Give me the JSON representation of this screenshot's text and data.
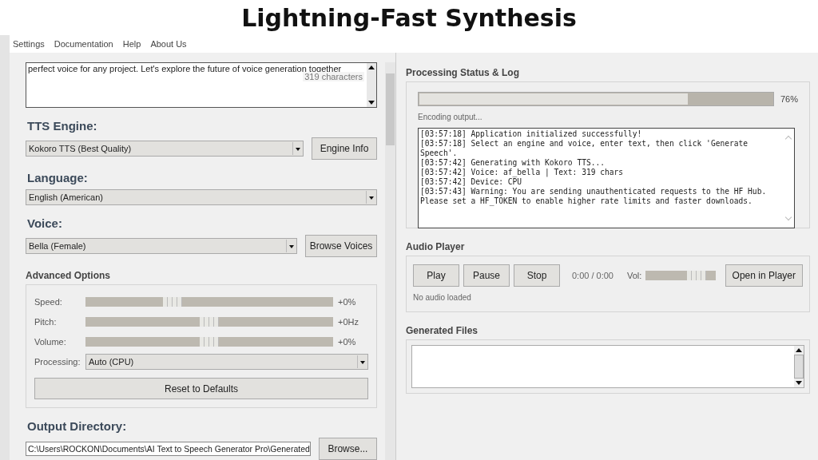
{
  "banner": {
    "title": "Lightning-Fast Synthesis"
  },
  "menu": [
    {
      "label": "Settings"
    },
    {
      "label": "Documentation"
    },
    {
      "label": "Help"
    },
    {
      "label": "About Us"
    }
  ],
  "text_input": {
    "value": "perfect voice for any project. Let's explore the future of voice generation together",
    "char_count": "319 characters"
  },
  "tts_engine": {
    "label": "TTS Engine:",
    "value": "Kokoro TTS (Best Quality)",
    "button": "Engine Info"
  },
  "language": {
    "label": "Language:",
    "value": "English (American)"
  },
  "voice": {
    "label": "Voice:",
    "value": "Bella (Female)",
    "button": "Browse Voices"
  },
  "advanced_options": {
    "title": "Advanced Options",
    "sliders": [
      {
        "label": "Speed:",
        "level": 0.35,
        "reading": "+0%"
      },
      {
        "label": "Pitch:",
        "level": 0.5,
        "reading": "+0Hz"
      },
      {
        "label": "Volume:",
        "level": 0.5,
        "reading": "+0%"
      }
    ],
    "processing": {
      "label": "Processing:",
      "value": "Auto (CPU)"
    },
    "reset_button": "Reset to Defaults"
  },
  "output_directory": {
    "label": "Output Directory:",
    "value": "C:\\Users\\ROCKON\\Documents\\AI Text to Speech Generator Pro\\Generated",
    "button": "Browse..."
  },
  "status": {
    "title": "Processing Status & Log",
    "level": 0.76,
    "reading": "76%",
    "message": "Encoding output...",
    "log": [
      "[03:57:18] Application initialized successfully!",
      "[03:57:18] Select an engine and voice, enter text, then click 'Generate Speech'.",
      "[03:57:42] Generating with Kokoro TTS...",
      "[03:57:42] Voice: af_bella | Text: 319 chars",
      "[03:57:42] Device: CPU",
      "[03:57:43] Warning: You are sending unauthenticated requests to the HF Hub. Please set a HF_TOKEN to enable higher rate limits and faster downloads."
    ]
  },
  "audio_player": {
    "title": "Audio Player",
    "buttons": [
      "Play",
      "Pause",
      "Stop"
    ],
    "time": "0:00 / 0:00",
    "volume_label": "Vol:",
    "volume": {
      "level": 0.72
    },
    "open_button": "Open in Player",
    "status": "No audio loaded"
  },
  "generated_files": {
    "title": "Generated Files"
  }
}
